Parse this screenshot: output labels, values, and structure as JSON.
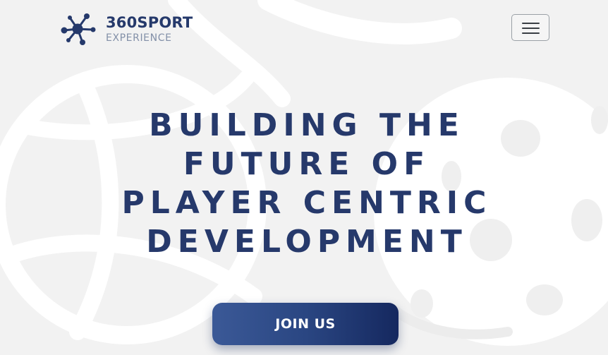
{
  "brand": {
    "name": "360SPORT",
    "subtitle": "EXPERIENCE",
    "logo_icon": "molecule-network-icon"
  },
  "nav": {
    "menu_icon": "hamburger-menu-icon"
  },
  "hero": {
    "headline_lines": [
      "BUILDING THE",
      "FUTURE OF",
      "PLAYER CENTRIC",
      "DEVELOPMENT"
    ],
    "cta_label": "JOIN US"
  },
  "colors": {
    "brand_navy": "#26396b",
    "brand_subtle": "#8390a8",
    "background": "#f2f2f2",
    "cta_gradient_start": "#3b5997",
    "cta_gradient_end": "#15285f"
  }
}
